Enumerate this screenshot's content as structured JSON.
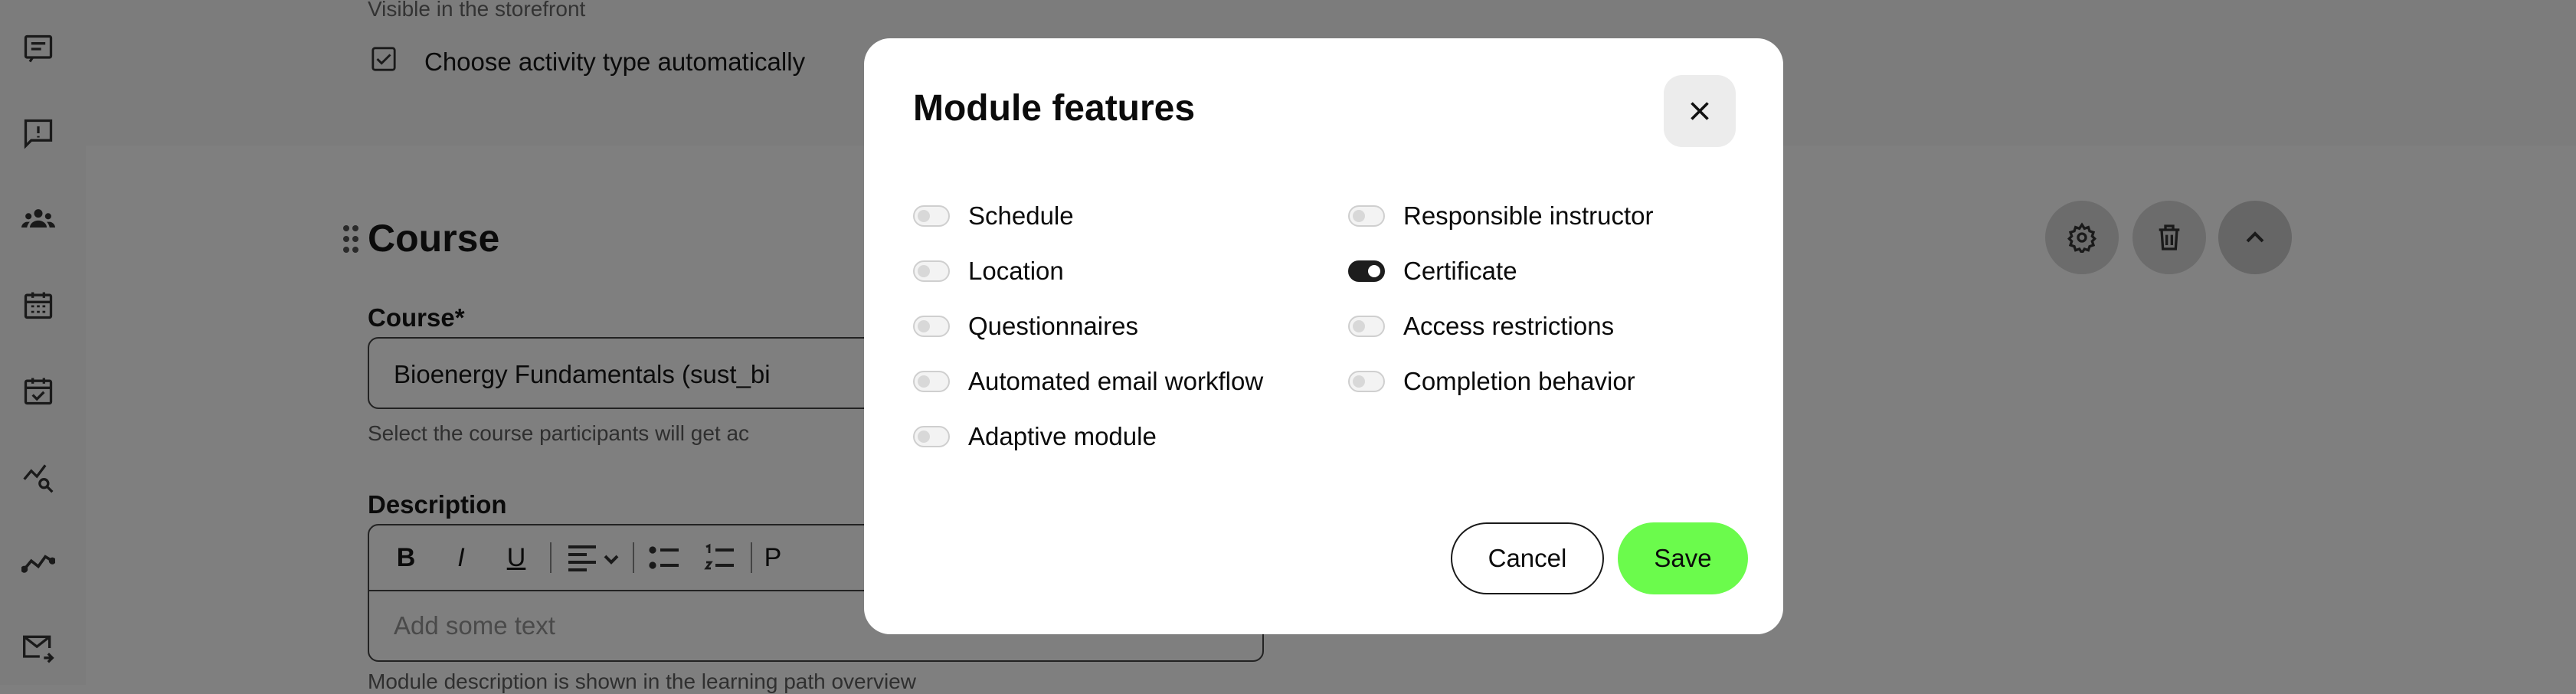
{
  "background": {
    "storefront_text": "Visible in the storefront",
    "auto_activity_label": "Choose activity type automatically",
    "course_section_title": "Course",
    "course_field_label": "Course*",
    "course_field_value": "Bioenergy Fundamentals (sust_bi",
    "course_field_help": "Select the course participants will get ac",
    "description_label": "Description",
    "description_placeholder": "Add some text",
    "description_help": "Module description is shown in the learning path overview",
    "toolbar": {
      "bold": "B",
      "italic": "I",
      "underline": "U",
      "paragraph": "P"
    }
  },
  "modal": {
    "title": "Module features",
    "features_left": [
      {
        "label": "Schedule",
        "enabled": false
      },
      {
        "label": "Location",
        "enabled": false
      },
      {
        "label": "Questionnaires",
        "enabled": false
      },
      {
        "label": "Automated email workflow",
        "enabled": false
      },
      {
        "label": "Adaptive module",
        "enabled": false
      }
    ],
    "features_right": [
      {
        "label": "Responsible instructor",
        "enabled": false
      },
      {
        "label": "Certificate",
        "enabled": true
      },
      {
        "label": "Access restrictions",
        "enabled": false
      },
      {
        "label": "Completion behavior",
        "enabled": false
      }
    ],
    "cancel_label": "Cancel",
    "save_label": "Save"
  },
  "colors": {
    "overlay": "#7f7f7f",
    "save_accent": "#6bfb4c",
    "toggle_on": "#1d1d1d"
  },
  "icons": {
    "sidebar": [
      "list-icon",
      "feedback-icon",
      "groups-icon",
      "calendar-icon",
      "calendar-check-icon",
      "analytics-search-icon",
      "trend-icon",
      "mail-forward-icon"
    ],
    "section_actions": [
      "gear-icon",
      "trash-icon",
      "chevron-up-icon"
    ]
  }
}
